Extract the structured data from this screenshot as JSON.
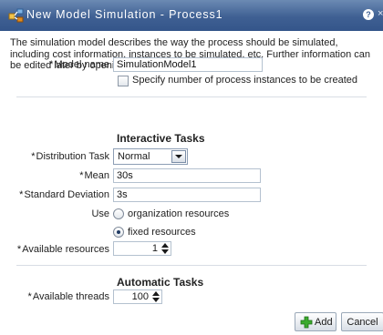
{
  "dialog": {
    "title": "New Model Simulation - Process1",
    "help_icon_text": "?",
    "close_hint": "×",
    "description": "The simulation model describes the way the process should be simulated, including cost information, instances to be simulated, etc. Further information can be edited later by opening the model from the tree"
  },
  "required_marker": "*",
  "model": {
    "name_label": "Model name",
    "name_value": "SimulationModel1",
    "specify_instances_label": "Specify number of process instances to be created",
    "specify_instances_checked": false
  },
  "interactive_tasks": {
    "section_title": "Interactive Tasks",
    "distribution_label": "Distribution Task",
    "distribution_value": "Normal",
    "mean_label": "Mean",
    "mean_value": "30s",
    "std_dev_label": "Standard Deviation",
    "std_dev_value": "3s",
    "use_label": "Use",
    "option_org_label": "organization resources",
    "option_fixed_label": "fixed resources",
    "selected_option": "fixed resources",
    "available_resources_label": "Available resources",
    "available_resources_value": "1"
  },
  "automatic_tasks": {
    "section_title": "Automatic Tasks",
    "available_threads_label": "Available threads",
    "available_threads_value": "100"
  },
  "buttons": {
    "add_label": "Add",
    "cancel_label": "Cancel"
  },
  "icons": {
    "title_icon": "simulation-model-icon",
    "add_icon": "green-plus-icon",
    "dropdown_icon": "chevron-down-icon",
    "spinner_icon": "up-down-arrows-icon"
  },
  "colors": {
    "titlebar": "#3f6093",
    "add_icon": "#3cab2e",
    "simulation_icon": "#e08b1e"
  }
}
